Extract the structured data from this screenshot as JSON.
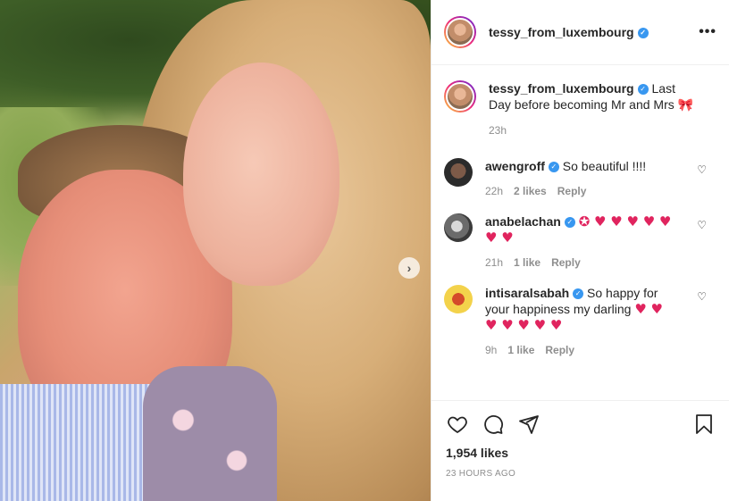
{
  "post": {
    "author": "tessy_from_luxembourg",
    "more_label": "•••",
    "next_label": "›",
    "caption": {
      "user": "tessy_from_luxembourg",
      "text": "Last Day before becoming Mr and Mrs",
      "emoji": "🎀",
      "time": "23h"
    }
  },
  "comments": [
    {
      "user": "awengroff",
      "text": "So beautiful !!!!",
      "time": "22h",
      "likes": "2 likes",
      "reply": "Reply"
    },
    {
      "user": "anabelachan",
      "text": "",
      "emojis": "✪ ♥ ♥ ♥ ♥ ♥ ♥ ♥",
      "time": "21h",
      "likes": "1 like",
      "reply": "Reply"
    },
    {
      "user": "intisaralsabah",
      "text": "So happy for your happiness my darling",
      "emojis": "♥ ♥ ♥ ♥ ♥ ♥ ♥",
      "time": "9h",
      "likes": "1 like",
      "reply": "Reply"
    }
  ],
  "footer": {
    "likes": "1,954 likes",
    "time_ago": "23 HOURS AGO"
  },
  "colors": {
    "verified": "#3897f0",
    "heart": "#e0245e",
    "muted": "#8e8e8e"
  }
}
